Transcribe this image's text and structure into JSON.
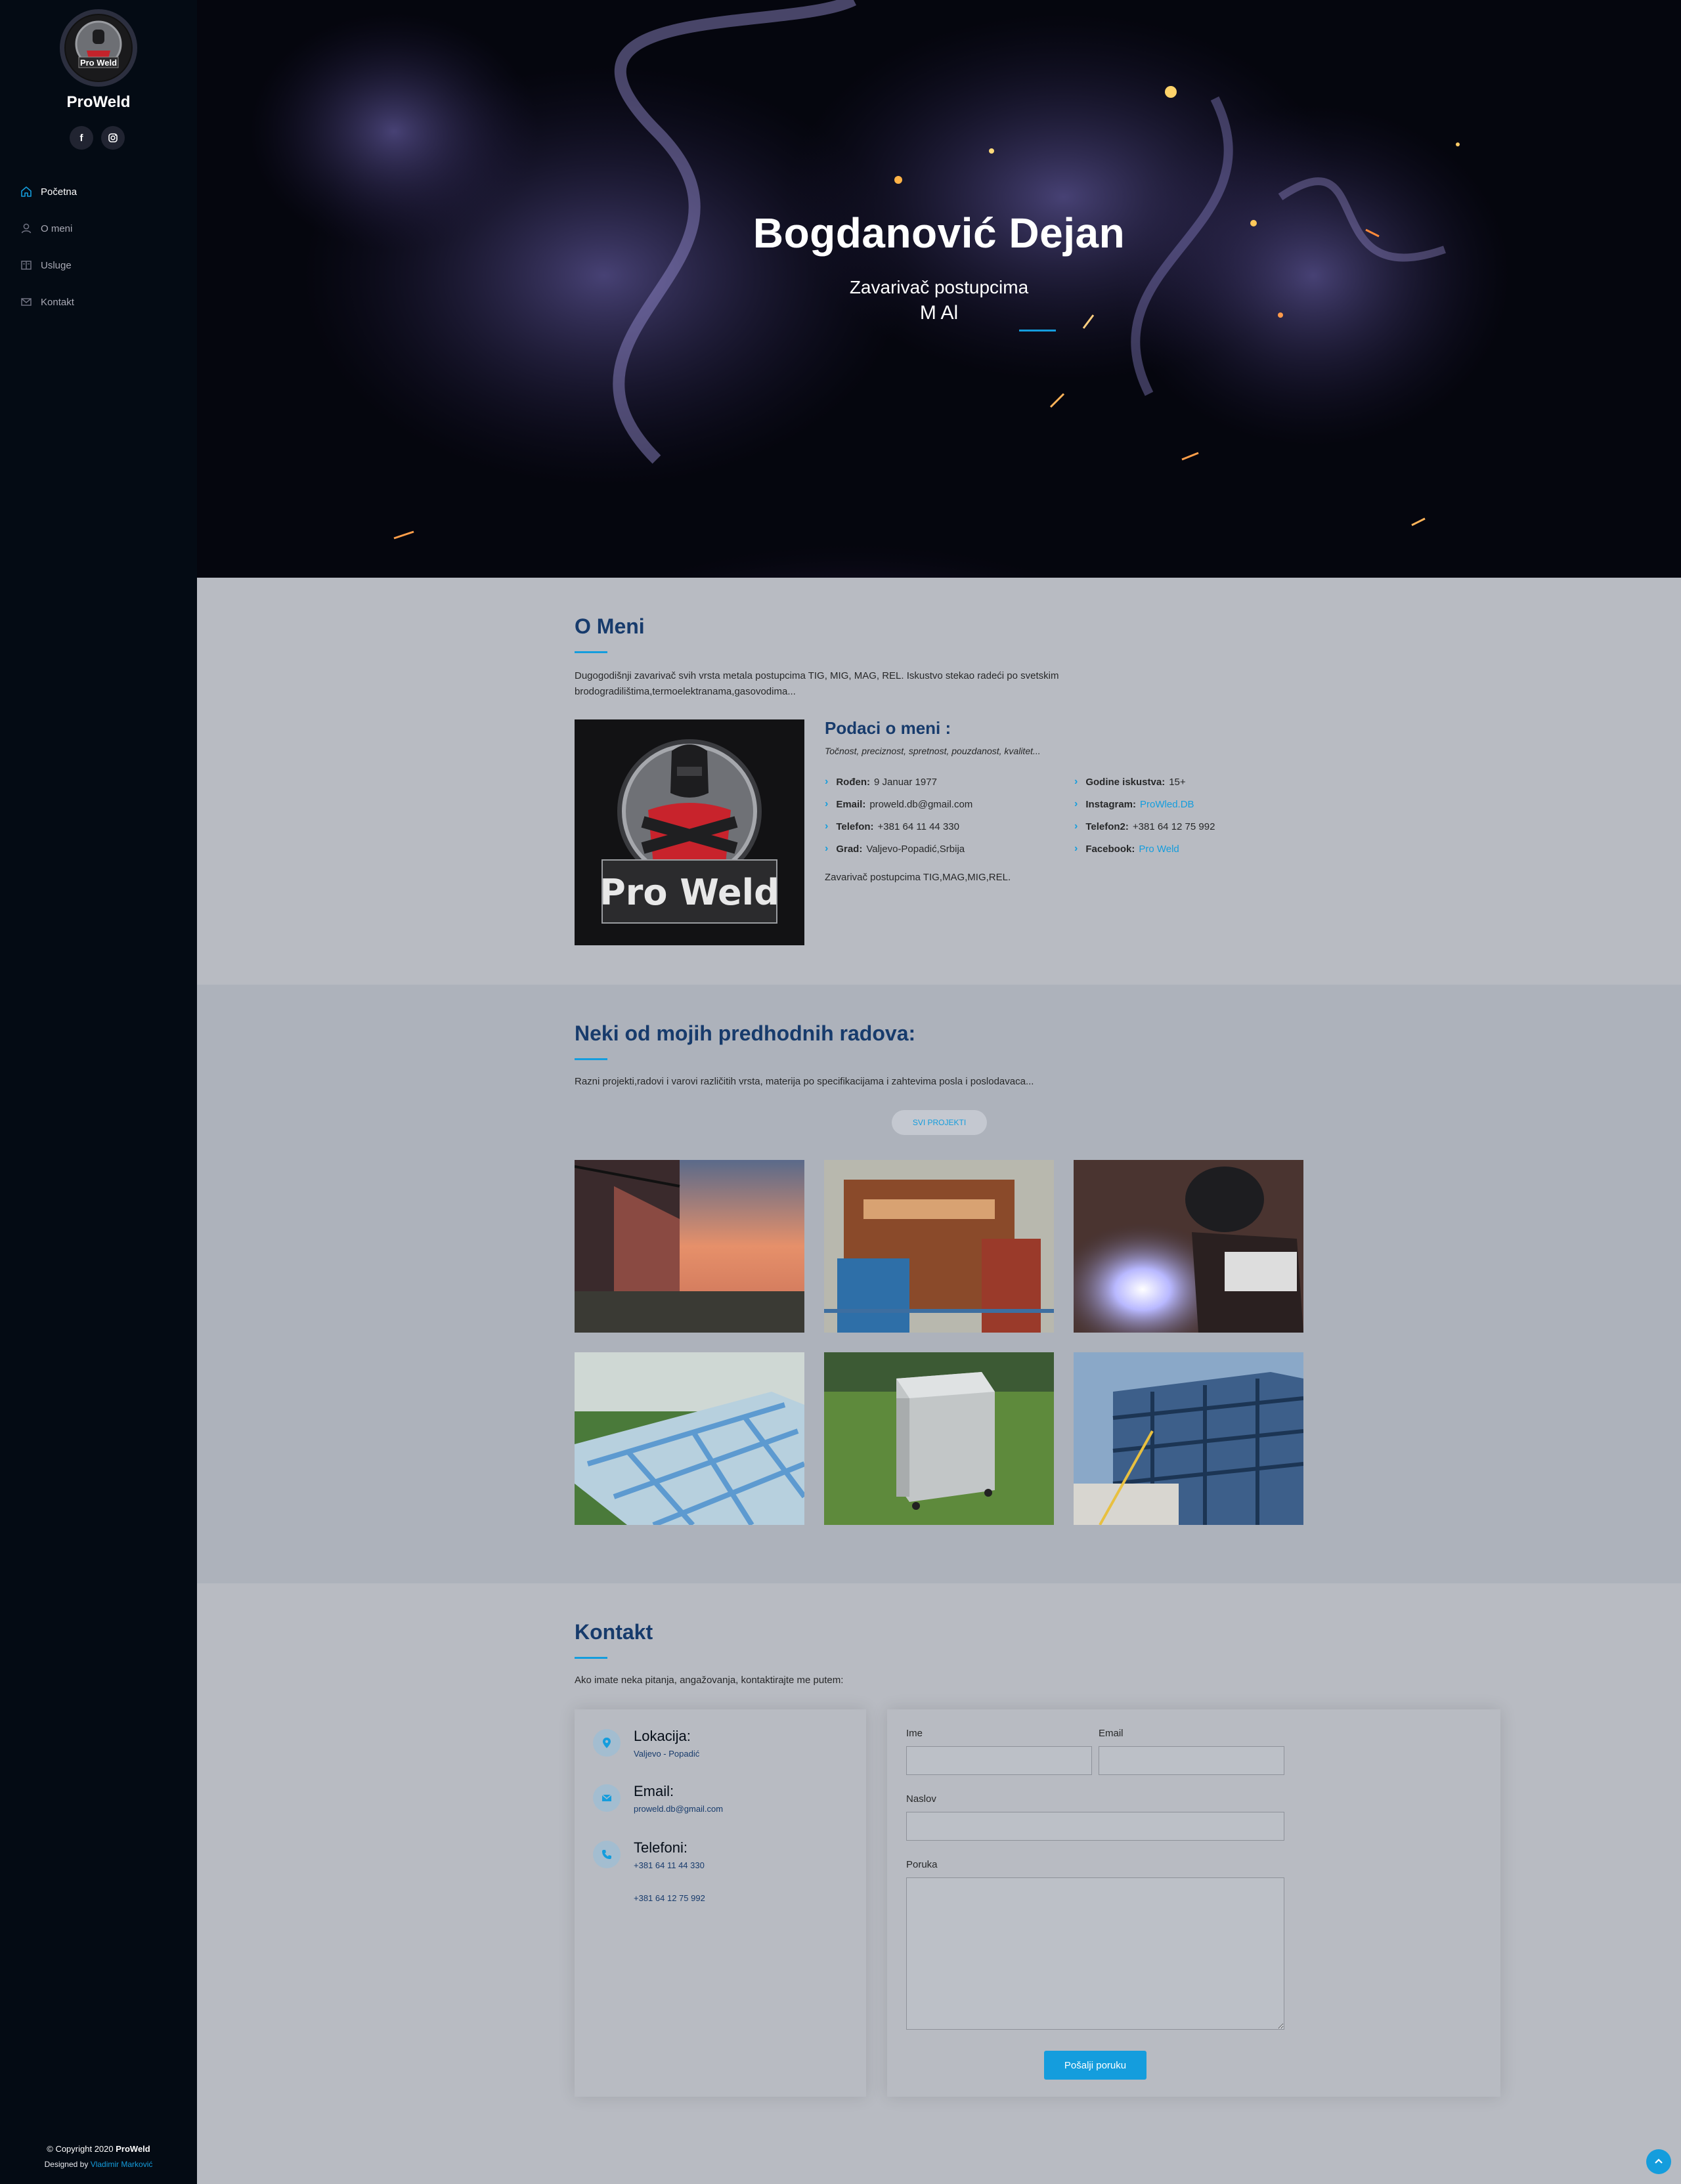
{
  "sidebar": {
    "logo_text": "Pro Weld",
    "brand": "ProWeld",
    "socials": [
      {
        "icon": "facebook-icon",
        "glyph": "f"
      },
      {
        "icon": "instagram-icon",
        "glyph": "◎"
      }
    ],
    "nav": [
      {
        "label": "Početna",
        "icon": "home-icon",
        "active": true
      },
      {
        "label": "O meni",
        "icon": "user-icon",
        "active": false
      },
      {
        "label": "Usluge",
        "icon": "book-icon",
        "active": false
      },
      {
        "label": "Kontakt",
        "icon": "envelope-icon",
        "active": false
      }
    ],
    "copyright_prefix": "© Copyright 2020",
    "copyright_brand": "ProWeld",
    "designed_prefix": "Designed by",
    "designed_by": "Vladimir Marković"
  },
  "hero": {
    "title": "Bogdanović Dejan",
    "subtitle": "Zavarivač postupcima",
    "typed": "M Al"
  },
  "about": {
    "title": "O Meni",
    "description": "Dugogodišnji zavarivač svih vrsta metala postupcima TIG, MIG, MAG, REL. Iskustvo stekao radeći po svetskim brodogradilištima,termoelektranama,gasovodima...",
    "image_text": "Pro Weld",
    "info_title": "Podaci o meni :",
    "tagline": "Točnost, preciznost, spretnost, pouzdanost, kvalitet...",
    "left": [
      {
        "label": "Rođen:",
        "value": "9 Januar 1977"
      },
      {
        "label": "Email:",
        "value": "proweld.db@gmail.com"
      },
      {
        "label": "Telefon:",
        "value": "+381 64 11 44 330"
      },
      {
        "label": "Grad:",
        "value": "Valjevo-Popadić,Srbija"
      }
    ],
    "right": [
      {
        "label": "Godine iskustva:",
        "value": "15+"
      },
      {
        "label": "Instagram:",
        "value": "ProWled.DB"
      },
      {
        "label": "Telefon2:",
        "value": "+381 64 12 75 992"
      },
      {
        "label": "Facebook:",
        "value": "Pro Weld"
      }
    ],
    "extra": "Zavarivač postupcima TIG,MAG,MIG,REL."
  },
  "portfolio": {
    "title": "Neki od mojih predhodnih radova:",
    "description": "Razni projekti,radovi i varovi različitih vrsta, materija po specifikacijama i zahtevima posla i poslodavaca...",
    "button": "SVI PROJEKTI"
  },
  "contact": {
    "title": "Kontakt",
    "description": "Ako imate neka pitanja, angažovanja, kontaktirajte me putem:",
    "location_title": "Lokacija:",
    "location_value": "Valjevo - Popadić",
    "email_title": "Email:",
    "email_value": "proweld.db@gmail.com",
    "phones_title": "Telefoni:",
    "phone1": "+381 64 11 44 330",
    "phone2": "+381 64 12 75 992",
    "form": {
      "name_label": "Ime",
      "email_label": "Email",
      "subject_label": "Naslov",
      "message_label": "Poruka",
      "submit": "Pošalji poruku"
    }
  },
  "colors": {
    "accent": "#149ddd",
    "heading": "#173b6c",
    "sidebar": "#040b14"
  }
}
